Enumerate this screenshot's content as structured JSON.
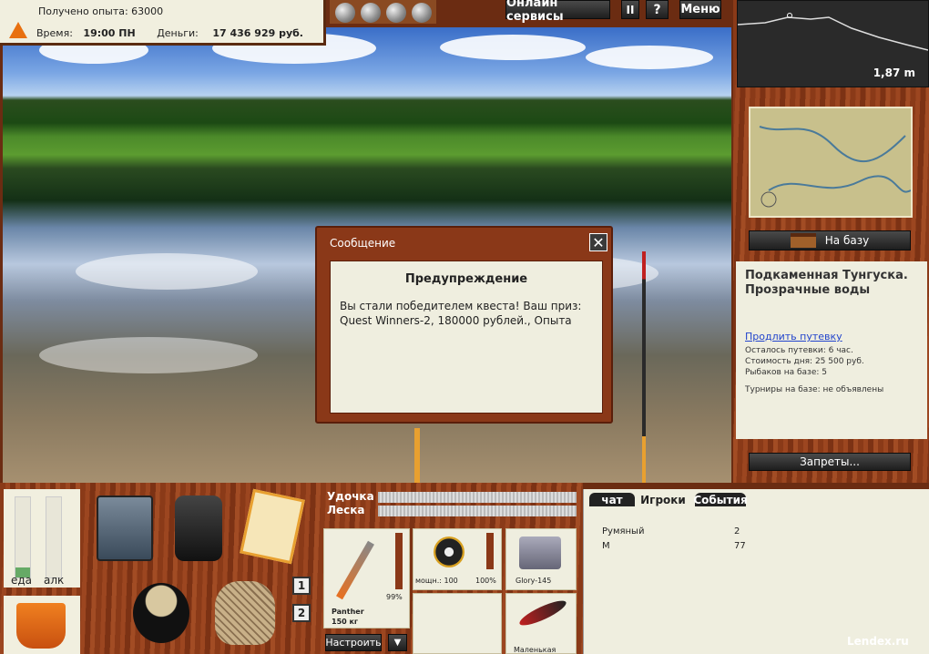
{
  "top": {
    "experience_label": "Получено опыта: 63000",
    "time_label": "Время:",
    "time_value": "19:00 ПН",
    "money_label": "Деньги:",
    "money_value": "17 436 929 руб."
  },
  "toolbar": {
    "online": "Онлайн сервисы",
    "pause": "II",
    "help": "?",
    "menu": "Меню"
  },
  "depth": "1,87 m",
  "message": {
    "title": "Сообщение",
    "heading": "Предупреждение",
    "text": "Вы стали победителем квеста! Ваш приз: Quest Winners-2, 180000 рублей., Опыта"
  },
  "location": {
    "to_base": "На базу",
    "name": "Подкаменная Тунгуска. Прозрачные воды",
    "extend_link": "Продлить путевку",
    "remaining": "Осталось путевки: 6 час.",
    "day_cost": "Стоимость дня: 25 500 руб.",
    "fishers": "Рыбаков на базе: 5",
    "tournaments": "Турниры на базе: не объявлены",
    "bans": "Запреты..."
  },
  "needs": {
    "food": "еда",
    "alcohol": "алк",
    "food_level": 0.12,
    "alcohol_level": 0
  },
  "inventory": {
    "slot1": "1",
    "slot2": "2"
  },
  "tackle": {
    "rod_label": "Удочка",
    "line_label": "Леска",
    "rod_name": "Panther",
    "rod_weight": "150 кг",
    "rod_pct": "99%",
    "reel_power": "мощн.: 100",
    "reel_pct": "100%",
    "lure": "Glory-145",
    "lure2": "Маленькая",
    "setup_btn": "Настроить",
    "down_btn": "▼"
  },
  "chat": {
    "tabs": [
      "чат",
      "Игроки",
      "События"
    ],
    "players": [
      {
        "name": "Румяный",
        "value": "2"
      },
      {
        "name": "М",
        "value": "77"
      }
    ]
  },
  "watermark": "Lendex.ru"
}
